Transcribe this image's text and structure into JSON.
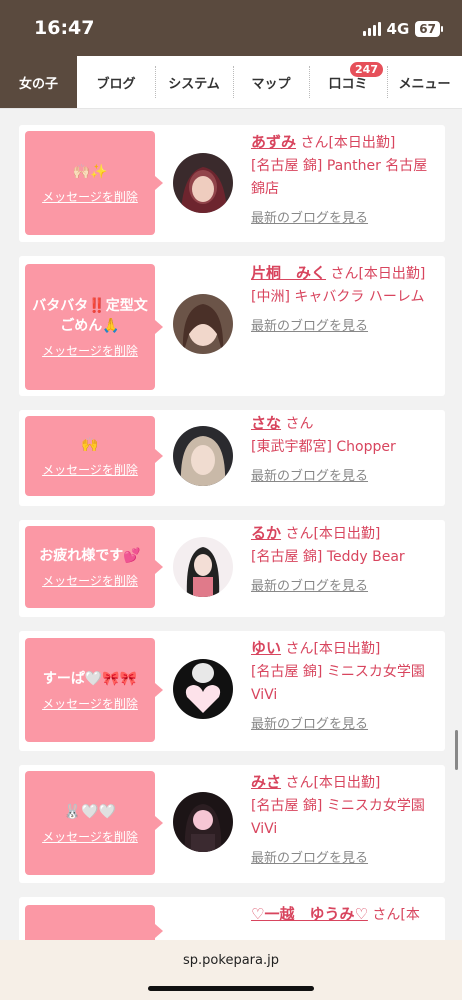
{
  "status": {
    "time": "16:47",
    "network": "4G",
    "battery": "67"
  },
  "nav": {
    "tabs": [
      {
        "label": "女の子",
        "active": true
      },
      {
        "label": "ブログ"
      },
      {
        "label": "システム"
      },
      {
        "label": "マップ"
      },
      {
        "label": "口コミ",
        "badge": "247"
      },
      {
        "label": "メニュー"
      }
    ]
  },
  "cards": [
    {
      "message": "🙌🏻✨",
      "delete": "メッセージを削除",
      "name": "あずみ",
      "san": "さん",
      "tag": "[本日出勤]",
      "shop": "[名古屋 錦] Panther 名古屋錦店",
      "blog": "最新のブログを見る"
    },
    {
      "message": "バタバタ‼️定型文ごめん🙏",
      "delete": "メッセージを削除",
      "name": "片桐　みく",
      "san": "さん",
      "tag": "[本日出勤]",
      "shop": "[中洲] キャバクラ ハーレム",
      "blog": "最新のブログを見る"
    },
    {
      "message": "🙌",
      "delete": "メッセージを削除",
      "name": "さな",
      "san": "さん",
      "tag": "",
      "shop": "[東武宇都宮] Chopper",
      "blog": "最新のブログを見る"
    },
    {
      "message": "お疲れ様です💕",
      "delete": "メッセージを削除",
      "name": "るか",
      "san": "さん",
      "tag": "[本日出勤]",
      "shop": "[名古屋 錦] Teddy Bear",
      "blog": "最新のブログを見る"
    },
    {
      "message": "すーぱ🤍🎀🎀",
      "delete": "メッセージを削除",
      "name": "ゆい",
      "san": "さん",
      "tag": "[本日出勤]",
      "shop": "[名古屋 錦] ミニスカ女学園ViVi",
      "blog": "最新のブログを見る"
    },
    {
      "message": "🐰🤍🤍",
      "delete": "メッセージを削除",
      "name": "みさ",
      "san": "さん",
      "tag": "[本日出勤]",
      "shop": "[名古屋 錦] ミニスカ女学園ViVi",
      "blog": "最新のブログを見る"
    },
    {
      "message": "",
      "delete": "",
      "name": "♡一越　ゆうみ♡",
      "san": "さん",
      "tag": "[本",
      "shop": "",
      "blog": ""
    }
  ],
  "browser": {
    "url": "sp.pokepara.jp"
  }
}
